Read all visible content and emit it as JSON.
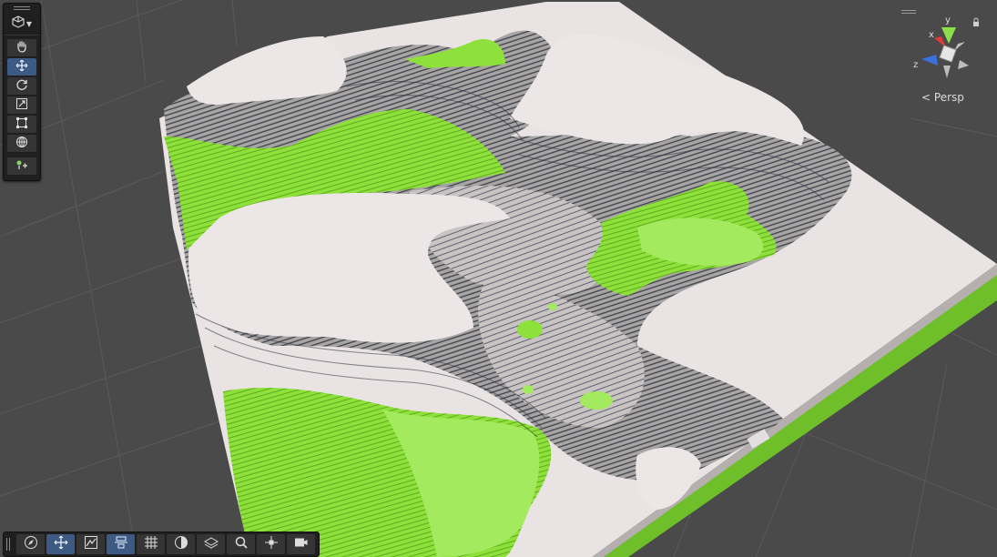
{
  "scene": {
    "projection_label": "Persp",
    "axes": {
      "x": "x",
      "y": "y",
      "z": "z"
    },
    "colors": {
      "background": "#4a4a4a",
      "grid_line": "#5a5a5a",
      "terrain_top": "#e9e4e3",
      "terrain_mid": "#9a9594",
      "terrain_shadow": "#2e3440",
      "grass": "#8ee03a",
      "grass_light": "#a6ec63",
      "terrain_side": "#b8b4b3",
      "accent_active": "#3d5a82",
      "axis_x": "#e03a3a",
      "axis_y": "#8de04a",
      "axis_z": "#3a6fe0"
    }
  },
  "tool_palette": {
    "view_tool": "view-options",
    "tools": [
      {
        "name": "hand-tool",
        "active": false
      },
      {
        "name": "move-tool",
        "active": true
      },
      {
        "name": "rotate-tool",
        "active": false
      },
      {
        "name": "scale-tool",
        "active": false
      },
      {
        "name": "rect-tool",
        "active": false
      },
      {
        "name": "transform-tool",
        "active": false
      },
      {
        "name": "custom-editor-tool",
        "active": false
      }
    ]
  },
  "bottom_toolbar": {
    "buttons": [
      {
        "name": "compass-tool",
        "active": false
      },
      {
        "name": "move-handle-tool",
        "active": true
      },
      {
        "name": "terrain-edit-tool",
        "active": false
      },
      {
        "name": "align-tool",
        "active": true
      },
      {
        "name": "grid-snap-tool",
        "active": false
      },
      {
        "name": "shading-tool",
        "active": false
      },
      {
        "name": "layer-tool",
        "active": false
      },
      {
        "name": "search-tool",
        "active": false
      },
      {
        "name": "pivot-tool",
        "active": false
      },
      {
        "name": "camera-tool",
        "active": false
      }
    ]
  }
}
